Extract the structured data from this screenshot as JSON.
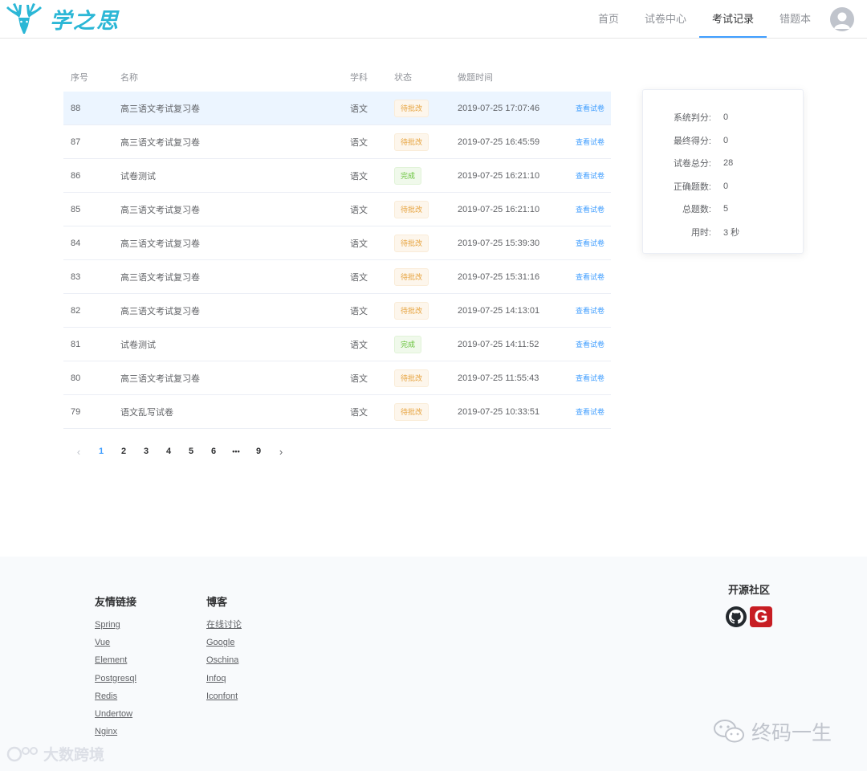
{
  "header": {
    "logo_text": "学之思",
    "nav": [
      "首页",
      "试卷中心",
      "考试记录",
      "错题本"
    ],
    "active_nav_index": 2
  },
  "table": {
    "headers": [
      "序号",
      "名称",
      "学科",
      "状态",
      "做题时间"
    ],
    "rows": [
      {
        "id": "88",
        "name": "高三语文考试复习卷",
        "subject": "语文",
        "status": "待批改",
        "status_type": "pending",
        "time": "2019-07-25 17:07:46",
        "action": "查看试卷"
      },
      {
        "id": "87",
        "name": "高三语文考试复习卷",
        "subject": "语文",
        "status": "待批改",
        "status_type": "pending",
        "time": "2019-07-25 16:45:59",
        "action": "查看试卷"
      },
      {
        "id": "86",
        "name": "试卷测试",
        "subject": "语文",
        "status": "完成",
        "status_type": "done",
        "time": "2019-07-25 16:21:10",
        "action": "查看试卷"
      },
      {
        "id": "85",
        "name": "高三语文考试复习卷",
        "subject": "语文",
        "status": "待批改",
        "status_type": "pending",
        "time": "2019-07-25 16:21:10",
        "action": "查看试卷"
      },
      {
        "id": "84",
        "name": "高三语文考试复习卷",
        "subject": "语文",
        "status": "待批改",
        "status_type": "pending",
        "time": "2019-07-25 15:39:30",
        "action": "查看试卷"
      },
      {
        "id": "83",
        "name": "高三语文考试复习卷",
        "subject": "语文",
        "status": "待批改",
        "status_type": "pending",
        "time": "2019-07-25 15:31:16",
        "action": "查看试卷"
      },
      {
        "id": "82",
        "name": "高三语文考试复习卷",
        "subject": "语文",
        "status": "待批改",
        "status_type": "pending",
        "time": "2019-07-25 14:13:01",
        "action": "查看试卷"
      },
      {
        "id": "81",
        "name": "试卷测试",
        "subject": "语文",
        "status": "完成",
        "status_type": "done",
        "time": "2019-07-25 14:11:52",
        "action": "查看试卷"
      },
      {
        "id": "80",
        "name": "高三语文考试复习卷",
        "subject": "语文",
        "status": "待批改",
        "status_type": "pending",
        "time": "2019-07-25 11:55:43",
        "action": "查看试卷"
      },
      {
        "id": "79",
        "name": "语文乱写试卷",
        "subject": "语文",
        "status": "待批改",
        "status_type": "pending",
        "time": "2019-07-25 10:33:51",
        "action": "查看试卷"
      }
    ]
  },
  "pagination": {
    "prev": "‹",
    "pages": [
      "1",
      "2",
      "3",
      "4",
      "5",
      "6",
      "•••",
      "9"
    ],
    "current": "1",
    "next": "›"
  },
  "stats": [
    {
      "label": "系统判分:",
      "value": "0"
    },
    {
      "label": "最终得分:",
      "value": "0"
    },
    {
      "label": "试卷总分:",
      "value": "28"
    },
    {
      "label": "正确题数:",
      "value": "0"
    },
    {
      "label": "总题数:",
      "value": "5"
    },
    {
      "label": "用时:",
      "value": "3 秒"
    }
  ],
  "footer": {
    "friend_links": {
      "title": "友情链接",
      "links": [
        "Spring",
        "Vue",
        "Element",
        "Postgresql",
        "Redis",
        "Undertow",
        "Nginx"
      ]
    },
    "blog": {
      "title": "博客",
      "links": [
        "在线讨论",
        "Google",
        "Oschina",
        "Infoq",
        "Iconfont"
      ]
    },
    "community": {
      "title": "开源社区",
      "gitee_letter": "G"
    }
  },
  "watermarks": {
    "left": "大数跨境",
    "right": "终码一生"
  },
  "colors": {
    "brand": "#2bb7d6",
    "primary": "#409eff",
    "pending": "#e6a23c",
    "done": "#67c23a"
  },
  "icons": [
    "deer-logo-icon",
    "user-avatar-icon",
    "github-icon",
    "gitee-icon",
    "wechat-icon"
  ]
}
